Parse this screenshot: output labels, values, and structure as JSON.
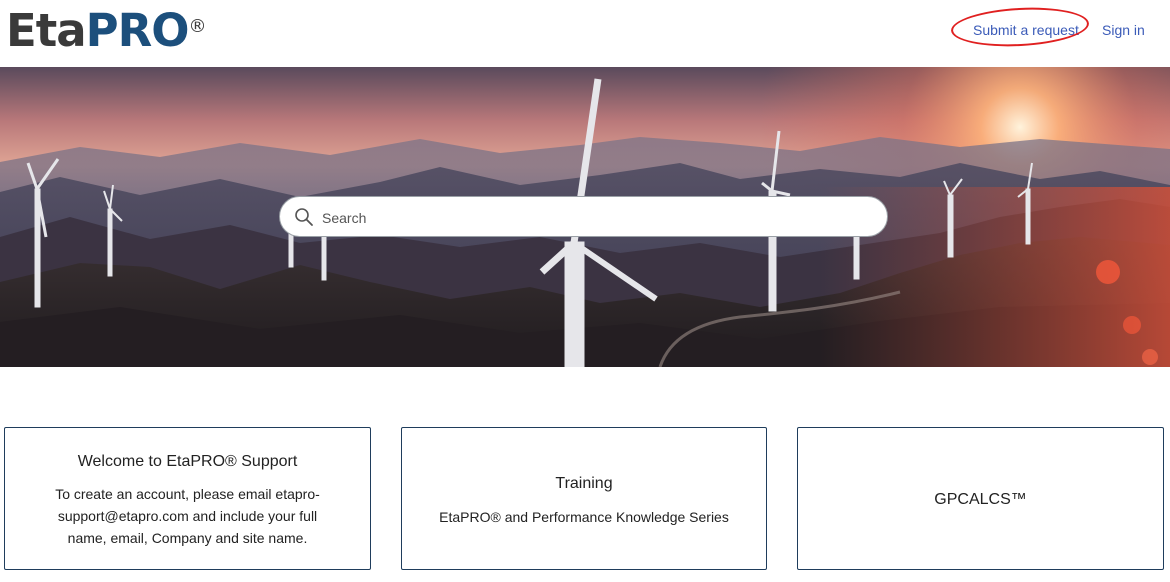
{
  "header": {
    "logo_eta": "Eta",
    "logo_pro": "PRO",
    "logo_reg": "®",
    "submit_request": "Submit a request",
    "sign_in": "Sign in"
  },
  "search": {
    "placeholder": "Search"
  },
  "cards": [
    {
      "title": "Welcome to EtaPRO® Support",
      "body": "To create an account, please email etapro-support@etapro.com and include your full name, email, Company and site name."
    },
    {
      "title": "Training",
      "body": "EtaPRO® and Performance Knowledge Series"
    },
    {
      "title": "GPCALCS™",
      "body": ""
    }
  ],
  "colors": {
    "link": "#3b5bb8",
    "logo_dark": "#3a3a3a",
    "logo_blue": "#1c4f7c",
    "card_border": "#1f3d5c",
    "annotation_red": "#e02020"
  }
}
